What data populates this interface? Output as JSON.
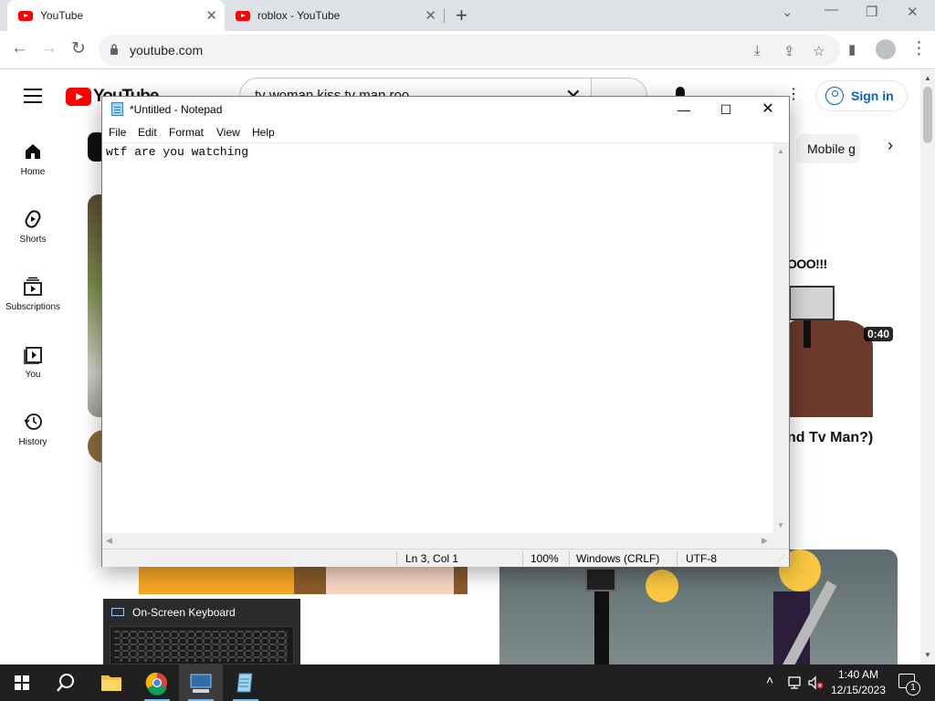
{
  "browser": {
    "tabs": [
      {
        "title": "YouTube",
        "active": true
      },
      {
        "title": "roblox - YouTube",
        "active": false
      }
    ],
    "new_tab_icon": "plus-icon",
    "window_controls": {
      "dropdown": "chevron-down-icon",
      "minimize": "minimize-icon",
      "restore": "restore-icon",
      "close": "close-icon"
    },
    "address": "youtube.com"
  },
  "youtube": {
    "logo_text": "YouTube",
    "search_query": "tv woman kiss tv man roo",
    "sign_in_label": "Sign in",
    "guide": [
      {
        "label": "Home",
        "icon": "home-icon"
      },
      {
        "label": "Shorts",
        "icon": "shorts-icon"
      },
      {
        "label": "Subscriptions",
        "icon": "subscriptions-icon"
      },
      {
        "label": "You",
        "icon": "you-library-icon"
      },
      {
        "label": "History",
        "icon": "history-icon"
      }
    ],
    "chip_partial": "Mobile g",
    "video_right": {
      "thumb_caption": "OOO!!!",
      "duration": "0:40",
      "title_partial": "nd Tv Man?)"
    },
    "accent_color": "#ff0000",
    "link_color": "#065fd4"
  },
  "notepad": {
    "title": "*Untitled - Notepad",
    "menu": [
      "File",
      "Edit",
      "Format",
      "View",
      "Help"
    ],
    "content": "wtf are you watching",
    "status": {
      "position": "Ln 3, Col 1",
      "zoom": "100%",
      "line_ending": "Windows (CRLF)",
      "encoding": "UTF-8"
    }
  },
  "osk_preview": {
    "title": "On-Screen Keyboard"
  },
  "taskbar": {
    "apps": [
      "start-icon",
      "search-icon",
      "file-explorer-icon",
      "chrome-icon",
      "on-screen-keyboard-icon",
      "notepad-icon"
    ],
    "time": "1:40 AM",
    "date": "12/15/2023",
    "notification_count": "1"
  }
}
